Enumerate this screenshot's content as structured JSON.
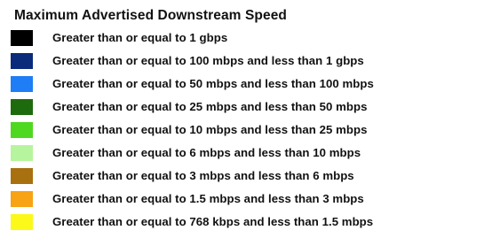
{
  "legend": {
    "title": "Maximum Advertised Downstream Speed",
    "items": [
      {
        "label": "Greater than or equal to 1 gbps",
        "color": "#000000"
      },
      {
        "label": "Greater than or equal to 100 mbps and less than 1 gbps",
        "color": "#0a2a7a"
      },
      {
        "label": "Greater than or equal to 50 mbps and less than 100 mbps",
        "color": "#1f7ef5"
      },
      {
        "label": "Greater than or equal to 25 mbps and less than 50 mbps",
        "color": "#1e6b0e"
      },
      {
        "label": "Greater than or equal to 10 mbps and less than 25 mbps",
        "color": "#4fd820"
      },
      {
        "label": "Greater than or equal to 6 mbps and less than 10 mbps",
        "color": "#b6f59e"
      },
      {
        "label": "Greater than or equal to 3 mbps and less than 6 mbps",
        "color": "#a8700e"
      },
      {
        "label": "Greater than or equal to 1.5 mbps and less than 3 mbps",
        "color": "#f8a215"
      },
      {
        "label": "Greater than or equal to 768 kbps and less than 1.5 mbps",
        "color": "#fbf81a"
      }
    ]
  }
}
